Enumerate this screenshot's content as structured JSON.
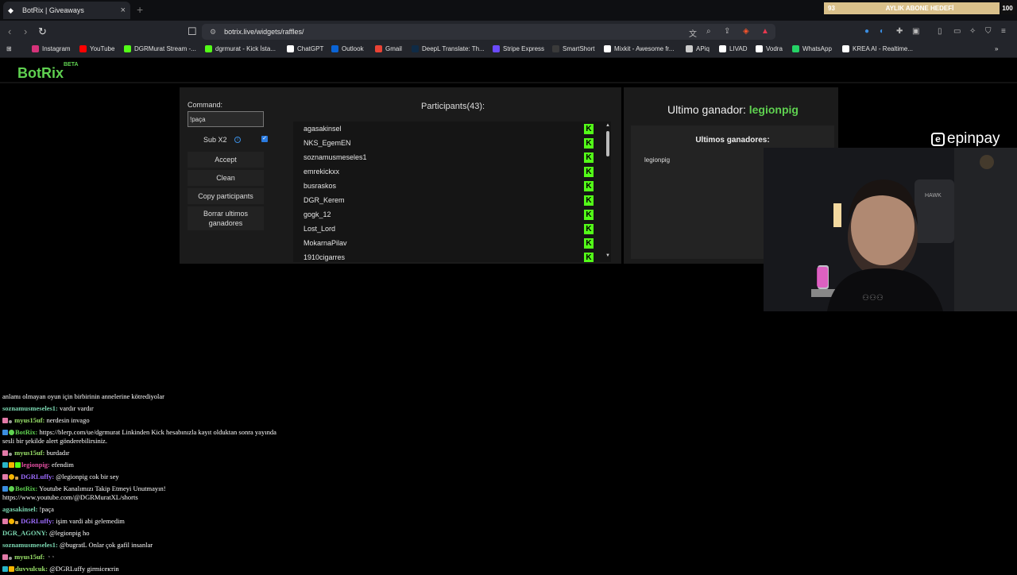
{
  "browser": {
    "tab_title": "BotRix | Giveaways",
    "url": "botrix.live/widgets/raffles/",
    "bookmarks": [
      "Instagram",
      "YouTube",
      "DGRMurat Stream -...",
      "dgrmurat - Kick İsta...",
      "ChatGPT",
      "Outlook",
      "Gmail",
      "DeepL Translate: Th...",
      "Stripe Express",
      "SmartShort",
      "Mixkit - Awesome fr...",
      "APiq",
      "LIVAD",
      "Vodra",
      "WhatsApp",
      "KREA AI - Realtime..."
    ],
    "bookmark_colors": [
      "#d6337a",
      "#ff0000",
      "#53fc18",
      "#53fc18",
      "#ffffff",
      "#0a64d6",
      "#ea4335",
      "#0f2b46",
      "#6b4bff",
      "#3a3a3a",
      "#ffffff",
      "#cccccc",
      "#ffffff",
      "#ffffff",
      "#25d366",
      "#ffffff"
    ]
  },
  "overlay_goal": {
    "current": "93",
    "title": "AYLIK ABONE HEDEFİ",
    "target": "100"
  },
  "app": {
    "logo": "BotRix",
    "logo_badge": "BETA",
    "brand_color": "#5fd150"
  },
  "raffle": {
    "command_label": "Command:",
    "command_value": "!paça",
    "sub_label": "Sub X2",
    "sub_checked": true,
    "buttons": {
      "accept": "Accept",
      "clean": "Clean",
      "copy": "Copy participants",
      "borrar": "Borrar ultimos ganadores"
    },
    "participants_header": "Participants(43):",
    "participants": [
      "agasakinsel",
      "NKS_EgemEN",
      "soznamusmeseles1",
      "emrekickxx",
      "busraskos",
      "DGR_Kerem",
      "gogk_12",
      "Lost_Lord",
      "MokarnaPilav",
      "1910cigarres"
    ],
    "last_winner_label": "Ultimo ganador:",
    "last_winner": "legionpig",
    "winners_header": "Ultimos ganadores:",
    "winners": [
      "legionpig"
    ]
  },
  "sponsor": "epinpay",
  "chat": [
    {
      "user": "",
      "color": "#ffffff",
      "text": "anlamı olmayan oyun için birbirinin annelerine kötrediyolar",
      "badges": []
    },
    {
      "user": "soznamusmeseles1:",
      "color": "#7ad6b0",
      "text": "vardır vardır",
      "badges": []
    },
    {
      "user": "myus15uf:",
      "color": "#9be36a",
      "text": "nerdesin invago",
      "badges": [
        "#e27aa8",
        "#999999"
      ]
    },
    {
      "user": "BotRix:",
      "color": "#5fd150",
      "text": "https://blerp.com/ue/dgrmurat Linkinden Kick hesabınızla kayıt olduktan sonra yayında sesli bir şekilde alert gönderebilirsiniz.",
      "badges": [
        "#3b8de0",
        "#5fd150"
      ]
    },
    {
      "user": "myus15uf:",
      "color": "#9be36a",
      "text": "burdadır",
      "badges": [
        "#e27aa8",
        "#999999"
      ]
    },
    {
      "user": "legionpig:",
      "color": "#e24fa0",
      "text": "efendim",
      "badges": [
        "#2ab5c9",
        "#f5b400",
        "#53fc18"
      ]
    },
    {
      "user": "DGRLuffy:",
      "color": "#9d6bff",
      "text": "@legionpig cok bir sey",
      "badges": [
        "#e27aa8",
        "#f5b400",
        "#d0a050"
      ]
    },
    {
      "user": "BotRix:",
      "color": "#5fd150",
      "text": "Youtube Kanalımızı Takip Etmeyi Unutmayın! https://www.youtube.com/@DGRMuratXL/shorts",
      "badges": [
        "#3b8de0",
        "#5fd150"
      ]
    },
    {
      "user": "agasakinsel:",
      "color": "#7ad6b0",
      "text": "!paça",
      "badges": []
    },
    {
      "user": "DGRLuffy:",
      "color": "#9d6bff",
      "text": "işim vardi abi gelemedim",
      "badges": [
        "#e27aa8",
        "#f5b400",
        "#d0a050"
      ]
    },
    {
      "user": "DGR_AGONY:",
      "color": "#7ad6b0",
      "text": "@legionpig ho",
      "badges": []
    },
    {
      "user": "soznamusmeseles1:",
      "color": "#7ad6b0",
      "text": "@bugratL Onlar çok gafil insanlar",
      "badges": []
    },
    {
      "user": "myus15uf:",
      "color": "#9be36a",
      "text": "",
      "badges": [
        "#e27aa8",
        "#999999"
      ]
    },
    {
      "user": "duvvulcuk:",
      "color": "#9be36a",
      "text": "@DGRLuffy girmiceктin",
      "badges": [
        "#2ab5c9",
        "#f5b400"
      ]
    }
  ]
}
